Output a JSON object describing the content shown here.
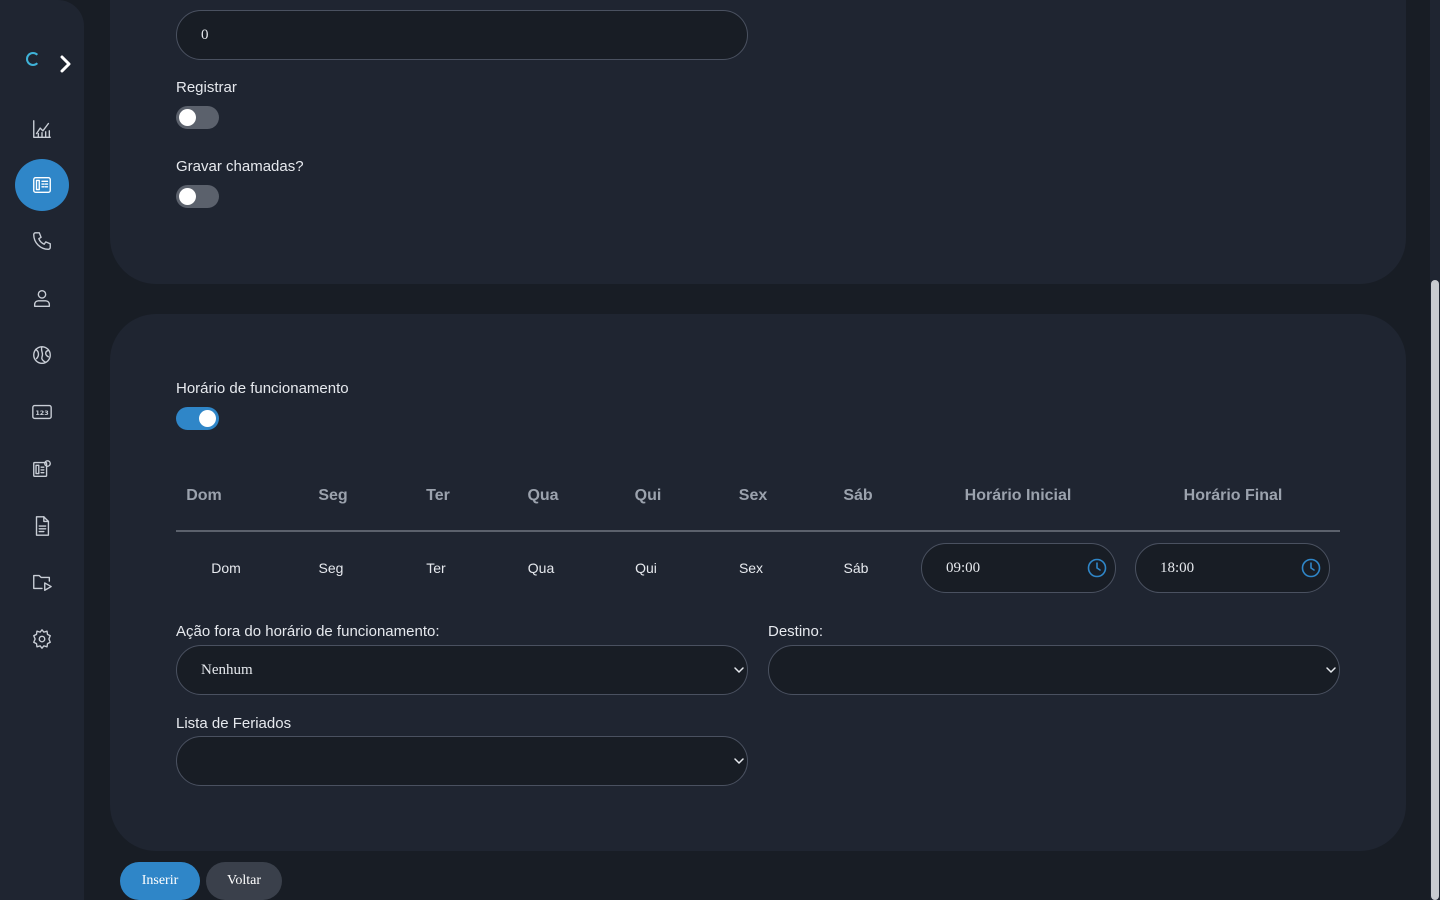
{
  "sidebar": {
    "icons": [
      "loading-spinner-icon",
      "chevron-right-icon",
      "chart-icon",
      "pbx-icon",
      "phone-icon",
      "user-icon",
      "globe-icon",
      "numbers-icon",
      "queue-icon",
      "document-icon",
      "media-folder-icon",
      "gear-icon"
    ],
    "active_item": "pbx"
  },
  "form_top": {
    "number_value": "0",
    "registrar_label": "Registrar",
    "registrar_on": false,
    "gravar_label": "Gravar chamadas?",
    "gravar_on": false
  },
  "schedule": {
    "label": "Horário de funcionamento",
    "enabled": true,
    "headers": [
      "Dom",
      "Seg",
      "Ter",
      "Qua",
      "Qui",
      "Sex",
      "Sáb",
      "Horário Inicial",
      "Horário Final"
    ],
    "days": [
      "Dom",
      "Seg",
      "Ter",
      "Qua",
      "Qui",
      "Sex",
      "Sáb"
    ],
    "start_time": "09:00",
    "end_time": "18:00"
  },
  "after_hours": {
    "action_label": "Ação fora do horário de funcionamento:",
    "action_value": "Nenhum",
    "destination_label": "Destino:",
    "destination_value": "",
    "holidays_label": "Lista de Feriados",
    "holidays_value": ""
  },
  "buttons": {
    "insert": "Inserir",
    "back": "Voltar"
  },
  "colors": {
    "accent": "#2f86c8",
    "background": "#181d25",
    "card": "#1f2531"
  }
}
